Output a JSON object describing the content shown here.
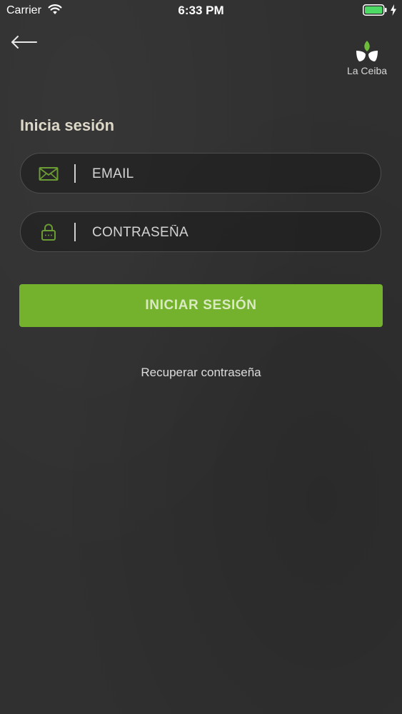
{
  "status_bar": {
    "carrier": "Carrier",
    "time": "6:33 PM",
    "wifi_icon": "wifi-icon",
    "battery_icon": "battery-icon",
    "battery_color": "#4cd964",
    "charging_icon": "bolt-icon"
  },
  "nav": {
    "back_icon": "arrow-left-icon",
    "brand_logo_icon": "leaf-icon",
    "brand_name": "La Ceiba",
    "brand_color": "#6dbb3a"
  },
  "login": {
    "title": "Inicia sesión",
    "email": {
      "icon": "envelope-icon",
      "value": "",
      "placeholder": "EMAIL"
    },
    "password": {
      "icon": "lock-icon",
      "value": "",
      "placeholder": "CONTRASEÑA"
    },
    "submit_label": "INICIAR SESIÓN",
    "accent_color": "#74b22e",
    "recover_label": "Recuperar contraseña"
  }
}
